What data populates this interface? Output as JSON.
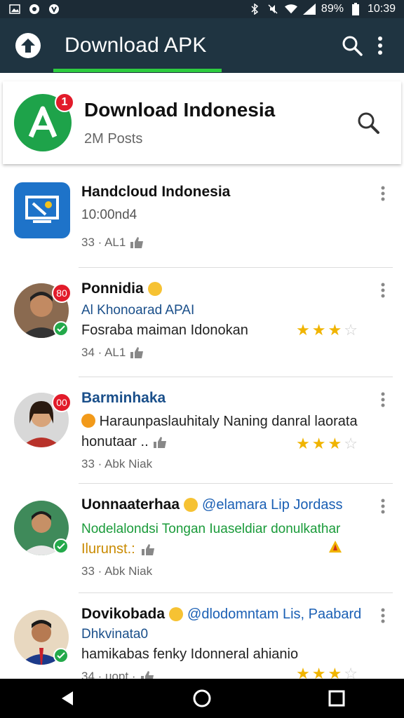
{
  "status": {
    "battery_pct": "89%",
    "time": "10:39"
  },
  "app_bar": {
    "title": "Download APK",
    "accent": "#2ecc40"
  },
  "header": {
    "title": "Download Indonesia",
    "subtitle": "2M Posts",
    "badge": "1"
  },
  "items": [
    {
      "title": "Handcloud Indonesia",
      "subtitle": "10:00nd4",
      "meta": "33 · AL1"
    },
    {
      "title": "Ponnidia",
      "badge": "80",
      "subtitle": "Al Khonoarad APAI",
      "desc": "Fosraba maiman Idonokan",
      "meta": "34 · AL1",
      "rating": 2.5
    },
    {
      "title": "Barminhaka",
      "badge": "00",
      "desc": "Haraunpaslauhitaly Naning danral laorata",
      "desc2": "honutaar ..",
      "meta": "33 · Abk Niak",
      "rating": 3
    },
    {
      "title": "Uonnaaterhaa",
      "handle": "@elamara Lip Jordass",
      "subtitle": "Nodelalondsi Tongan Iuaseldiar donulkathar",
      "desc": "Ilurunst.:",
      "meta": "33 · Abk Niak"
    },
    {
      "title": "Dovikobada",
      "handle": "@dlodomntam Lis, Paabard",
      "subtitle": "Dhkvinata0",
      "desc": "hamikabas fenky Idonneral ahianio",
      "meta": "34 · uopt ·",
      "rating": 3
    }
  ]
}
